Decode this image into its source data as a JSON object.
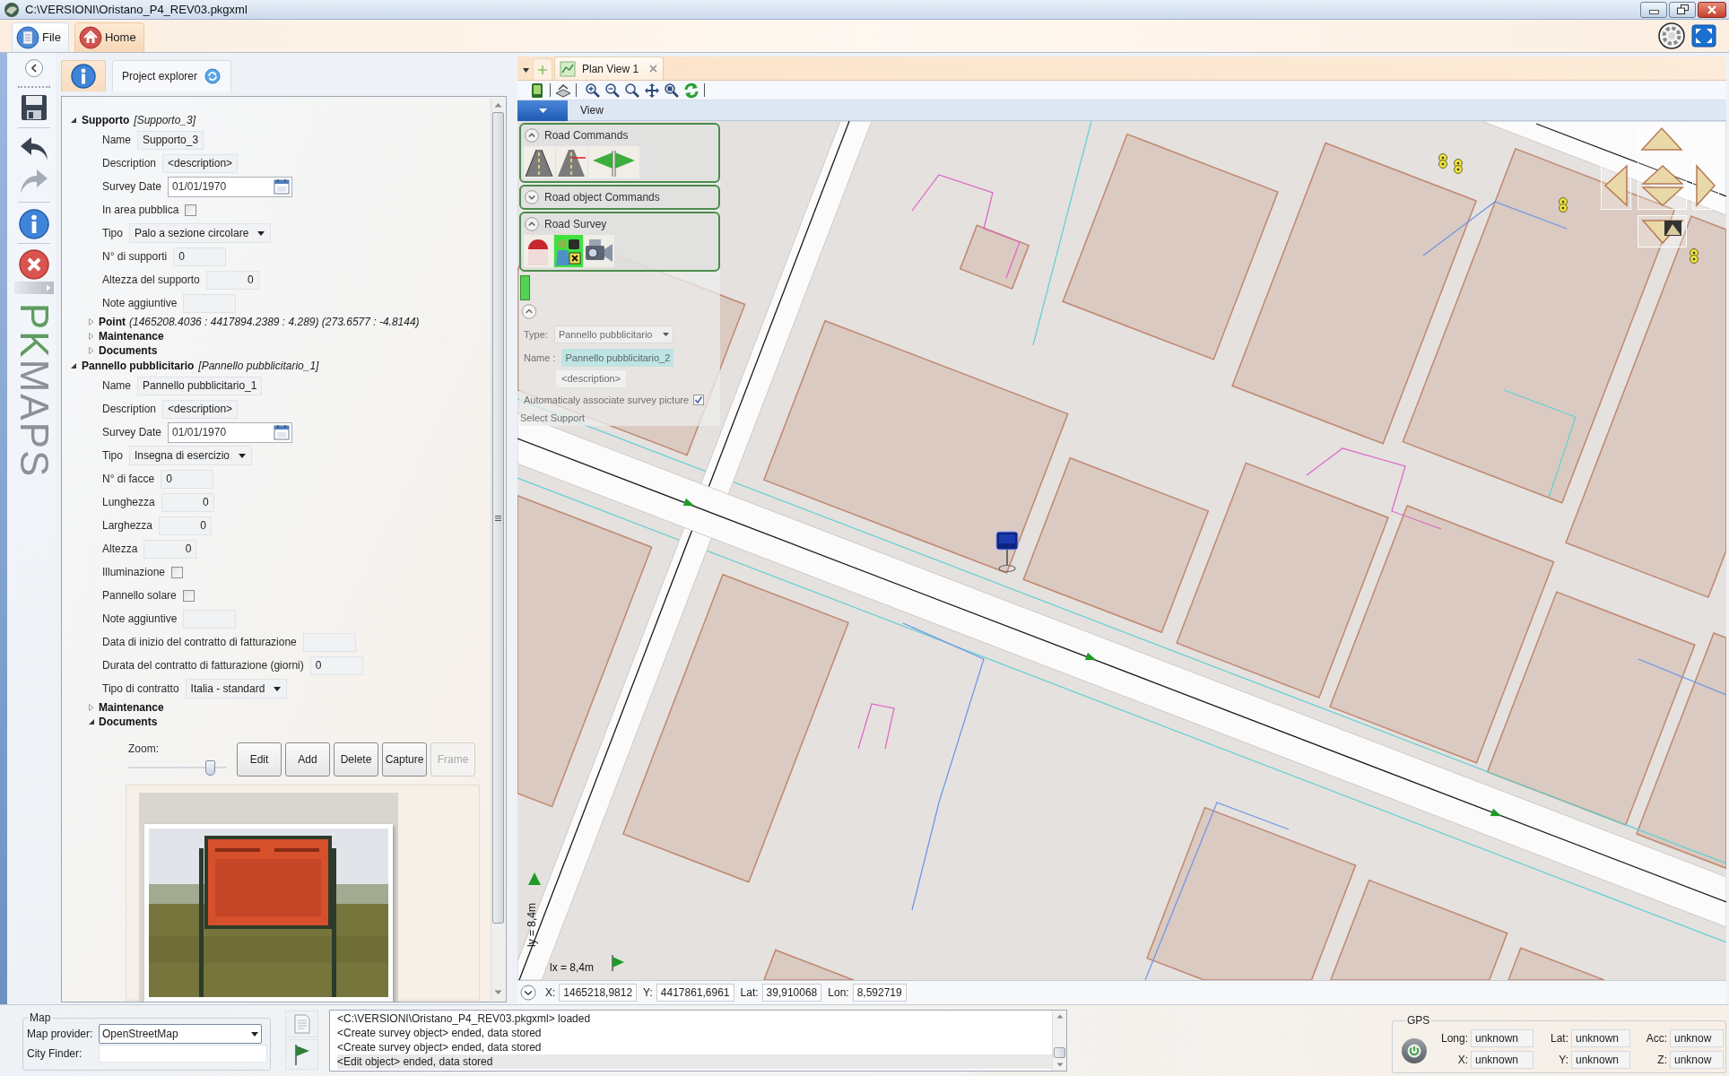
{
  "window": {
    "title": "C:\\VERSIONI\\Oristano_P4_REV03.pkgxml"
  },
  "ribbon_tabs": [
    {
      "kind": "file",
      "label": "File",
      "selected": false
    },
    {
      "kind": "home",
      "label": "Home",
      "selected": true
    }
  ],
  "side_toolbar": [
    {
      "kind": "save",
      "disabled": false
    },
    {
      "kind": "undo",
      "disabled": false
    },
    {
      "kind": "redo",
      "disabled": true
    },
    {
      "kind": "info",
      "disabled": false
    },
    {
      "kind": "delete",
      "disabled": false
    }
  ],
  "logo": {
    "accent": "PK",
    "rest": "MAPS"
  },
  "panel_tabs": [
    {
      "kind": "info",
      "selected": true
    },
    {
      "kind": "text",
      "label": "Project explorer",
      "selected": false
    }
  ],
  "properties": [
    {
      "title": "Supporto",
      "detail": "[Supporto_3]",
      "expanded": true,
      "fields": [
        {
          "kind": "text",
          "label": "Name",
          "value": "Supporto_3"
        },
        {
          "kind": "text",
          "label": "Description",
          "value": "<description>"
        },
        {
          "kind": "date",
          "label": "Survey Date",
          "value": "01/01/1970"
        },
        {
          "kind": "checkbox",
          "label": "In area pubblica",
          "checked": false
        },
        {
          "kind": "dropdown",
          "label": "Tipo",
          "value": "Palo a sezione circolare"
        },
        {
          "kind": "text",
          "label": "N° di supporti",
          "value": "0"
        },
        {
          "kind": "number",
          "label": "Altezza del supporto",
          "value": "0"
        },
        {
          "kind": "text",
          "label": "Note aggiuntive"
        }
      ],
      "groups": [
        {
          "title": "Point",
          "detail": "(1465208.4036 : 4417894.2389 : 4.289) (273.6577 : -4.8144)",
          "expanded": false
        },
        {
          "title": "Maintenance",
          "expanded": false
        },
        {
          "title": "Documents",
          "expanded": false
        }
      ]
    },
    {
      "title": "Pannello pubblicitario",
      "detail": "[Pannello pubblicitario_1]",
      "expanded": true,
      "fields": [
        {
          "kind": "text",
          "label": "Name",
          "value": "Pannello pubblicitario_1"
        },
        {
          "kind": "text",
          "label": "Description",
          "value": "<description>"
        },
        {
          "kind": "date",
          "label": "Survey Date",
          "value": "01/01/1970"
        },
        {
          "kind": "dropdown",
          "label": "Tipo",
          "value": "Insegna di esercizio"
        },
        {
          "kind": "text",
          "label": "N° di facce",
          "value": "0"
        },
        {
          "kind": "number",
          "label": "Lunghezza",
          "value": "0"
        },
        {
          "kind": "number",
          "label": "Larghezza",
          "value": "0"
        },
        {
          "kind": "number",
          "label": "Altezza",
          "value": "0"
        },
        {
          "kind": "checkbox",
          "label": "Illuminazione",
          "checked": false
        },
        {
          "kind": "checkbox",
          "label": "Pannello solare",
          "checked": false
        },
        {
          "kind": "text",
          "label": "Note aggiuntive"
        },
        {
          "kind": "text",
          "label": "Data di inizio del contratto di fatturazione"
        },
        {
          "kind": "text",
          "label": "Durata del contratto di fatturazione (giorni)",
          "value": "0"
        },
        {
          "kind": "dropdown",
          "label": "Tipo di contratto",
          "value": "Italia - standard"
        }
      ],
      "groups": [
        {
          "title": "Maintenance",
          "expanded": false
        },
        {
          "title": "Documents",
          "expanded": true,
          "zoom_label": "Zoom:",
          "zoom": {
            "level": 0.87
          },
          "buttons": [
            {
              "label": "Edit",
              "disabled": false
            },
            {
              "label": "Add",
              "disabled": false
            },
            {
              "label": "Delete",
              "disabled": false
            },
            {
              "label": "Capture",
              "disabled": false
            },
            {
              "label": "Frame",
              "disabled": true
            }
          ]
        }
      ]
    }
  ],
  "map_view": {
    "tabs": [
      {
        "label": "Plan View 1",
        "selected": true
      }
    ],
    "menu_label": "View",
    "road_panel": {
      "sections": [
        {
          "title": "Road Commands",
          "expanded": true,
          "tools": [
            {
              "kind": "road",
              "selected": false
            },
            {
              "kind": "road_edit",
              "selected": false
            },
            {
              "kind": "flags",
              "selected": false
            }
          ]
        },
        {
          "title": "Road object Commands",
          "expanded": false
        },
        {
          "title": "Road Survey",
          "expanded": true,
          "tools": [
            {
              "kind": "dome",
              "selected": false
            },
            {
              "kind": "person",
              "selected": true
            },
            {
              "kind": "camera",
              "selected": false
            }
          ]
        }
      ],
      "form": {
        "type_label": "Type:",
        "type_value": "Pannello pubblicitario",
        "name_label": "Name :",
        "name_value": "Pannello pubblicitario_2",
        "description": "<description>",
        "auto_picture_label": "Automaticaly associate survey picture",
        "auto_picture": true,
        "hint": "Select Support"
      }
    },
    "scale": {
      "y_label": "ly = 8,4m",
      "x_label": "lx = 8,4m"
    },
    "coordinates": [
      {
        "label": "X:",
        "value": "1465218,9812"
      },
      {
        "label": "Y:",
        "value": "4417861,6961"
      },
      {
        "label": "Lat:",
        "value": "39,910068"
      },
      {
        "label": "Lon:",
        "value": "8,592719"
      }
    ]
  },
  "map_settings": {
    "title": "Map",
    "provider_label": "Map provider:",
    "provider": "OpenStreetMap",
    "city_label": "City Finder:"
  },
  "log": [
    {
      "text": "<C:\\VERSIONI\\Oristano_P4_REV03.pkgxml> loaded",
      "selected": false
    },
    {
      "text": "<Create survey object> ended, data stored",
      "selected": false
    },
    {
      "text": "<Create survey object> ended, data stored",
      "selected": false
    },
    {
      "text": "<Edit object> ended, data stored",
      "selected": true
    }
  ],
  "gps": {
    "title": "GPS",
    "fields": [
      {
        "label": "Long:",
        "value": "unknown"
      },
      {
        "label": "Lat:",
        "value": "unknown"
      },
      {
        "label": "Acc:",
        "value": "unknow"
      },
      {
        "label": "X:",
        "value": "unknown"
      },
      {
        "label": "Y:",
        "value": "unknown"
      },
      {
        "label": "Z:",
        "value": "unknow"
      }
    ]
  }
}
